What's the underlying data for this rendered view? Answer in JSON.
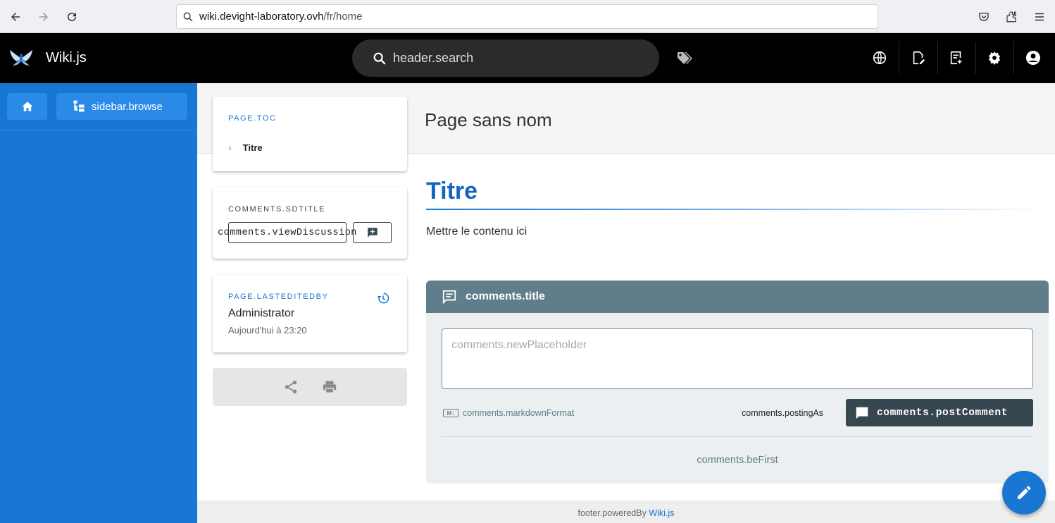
{
  "browser": {
    "url_host": "wiki.devight-laboratory.ovh",
    "url_path": "/fr/home"
  },
  "header": {
    "app_title": "Wiki.js",
    "search_placeholder": "header.search"
  },
  "sidebar": {
    "browse_label": "sidebar.browse"
  },
  "page": {
    "title": "Page sans nom",
    "heading": "Titre",
    "body_text": "Mettre le contenu ici"
  },
  "toc": {
    "overline": "PAGE.TOC",
    "items": [
      "Titre"
    ]
  },
  "comments_card": {
    "overline": "COMMENTS.SDTITLE",
    "view_discussion": "comments.viewDiscussion"
  },
  "last_edit": {
    "overline": "PAGE.LASTEDITEDBY",
    "author": "Administrator",
    "date": "Aujourd'hui à 23:20"
  },
  "comments": {
    "title": "comments.title",
    "placeholder": "comments.newPlaceholder",
    "markdown_badge": "M↓",
    "markdown_format": "comments.markdownFormat",
    "posting_as": "comments.postingAs",
    "post_button": "comments.postComment",
    "be_first": "comments.beFirst"
  },
  "footer": {
    "powered_by": "footer.poweredBy",
    "link": "Wiki.js"
  },
  "colors": {
    "accent": "#1976d2",
    "header_bg": "#000000",
    "comments_header": "#607d8b",
    "post_button": "#37474f"
  },
  "icons": [
    "back-icon",
    "forward-icon",
    "reload-icon",
    "search-icon",
    "pocket-icon",
    "extensions-icon",
    "menu-icon",
    "wikijs-logo",
    "tags-icon",
    "language-icon",
    "edit-page-icon",
    "new-page-icon",
    "settings-icon",
    "account-icon",
    "home-icon",
    "browse-tree-icon",
    "comment-add-icon",
    "history-icon",
    "share-icon",
    "print-icon",
    "comment-icon",
    "pencil-icon"
  ]
}
